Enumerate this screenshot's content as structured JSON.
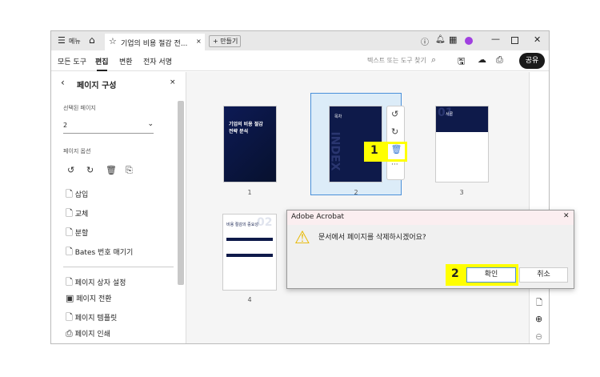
{
  "titlebar": {
    "menu": "메뉴",
    "tab_title": "기업의 비용 절감 전...",
    "new_button": "만들기"
  },
  "toolbar": {
    "tabs": [
      "모든 도구",
      "편집",
      "변환",
      "전자 서명"
    ],
    "search_placeholder": "텍스트 또는 도구 찾기",
    "share": "공유"
  },
  "panel": {
    "title": "페이지 구성",
    "selected_label": "선택된 페이지",
    "selected_value": "2",
    "options_label": "페이지 옵션",
    "items": [
      "삽입",
      "교체",
      "분할",
      "Bates 번호 매기기"
    ],
    "items2": [
      "페이지 상자 설정",
      "페이지 전환",
      "페이지 템플릿",
      "페이지 인쇄"
    ]
  },
  "pages": [
    {
      "label": "1",
      "title": "기업의 비용 절감 전략 분석"
    },
    {
      "label": "2",
      "title": "목차",
      "watermark": "INDEX"
    },
    {
      "label": "3",
      "title": "서론",
      "num": "01"
    },
    {
      "label": "4",
      "title": "비용 절감의 중요성",
      "num": "02"
    }
  ],
  "dialog": {
    "title": "Adobe Acrobat",
    "message": "문서에서 페이지를 삭제하시겠어요?",
    "confirm": "확인",
    "cancel": "취소"
  },
  "annotations": {
    "step1": "1",
    "step2": "2"
  }
}
